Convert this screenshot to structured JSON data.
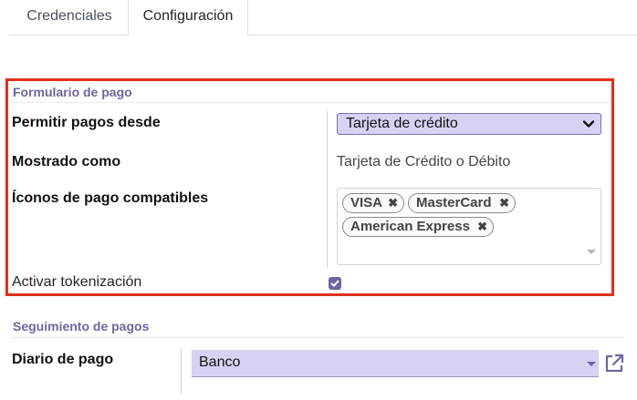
{
  "tabs": [
    {
      "label": "Credenciales"
    },
    {
      "label": "Configuración"
    }
  ],
  "payment_form": {
    "section_title": "Formulario de pago",
    "allow_payments_label": "Permitir pagos desde",
    "allow_payments_value": "Tarjeta de crédito",
    "displayed_as_label": "Mostrado como",
    "displayed_as_value": "Tarjeta de Crédito o Débito",
    "icons_label": "Íconos de pago compatibles",
    "icons": [
      "VISA",
      "MasterCard",
      "American Express"
    ],
    "tokenization_label": "Activar tokenización",
    "tokenization_checked": true
  },
  "payment_followup": {
    "section_title": "Seguimiento de pagos",
    "journal_label": "Diario de pago",
    "journal_value": "Banco"
  },
  "colors": {
    "accent": "#71639e",
    "highlight": "#e0301e",
    "select_bg": "#d6d2f3"
  }
}
